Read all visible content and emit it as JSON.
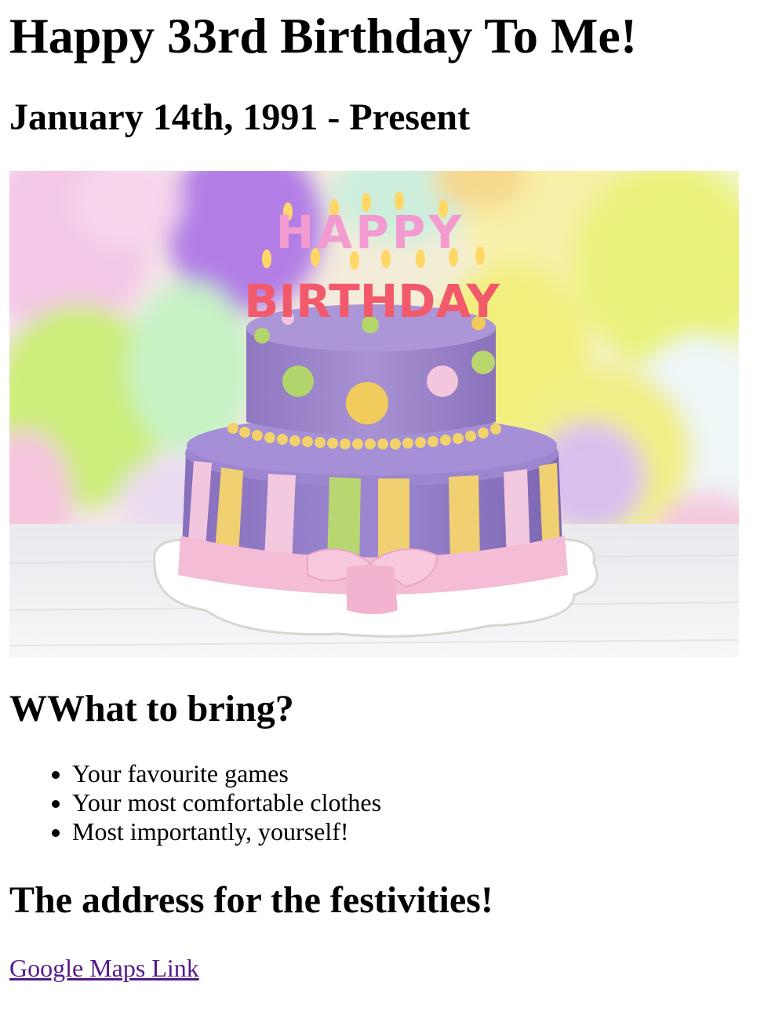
{
  "page": {
    "title": "Happy 33rd Birthday To Me!",
    "subtitle": "January 14th, 1991 - Present"
  },
  "hero_image": {
    "candle_text_top": "HAPPY",
    "candle_text_bottom": "BIRTHDAY"
  },
  "bring_section": {
    "heading": "WWhat to bring?",
    "items": [
      "Your favourite games",
      "Your most comfortable clothes",
      "Most importantly, yourself!"
    ]
  },
  "address_section": {
    "heading": "The address for the festivities!",
    "link_label": "Google Maps Link"
  },
  "colors": {
    "text": "#000000",
    "visited_link": "#551a8b",
    "background": "#ffffff"
  }
}
